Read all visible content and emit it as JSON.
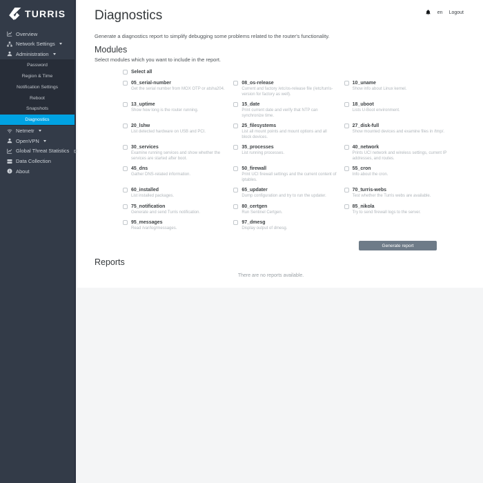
{
  "brand": {
    "name": "TURRIS"
  },
  "topbar": {
    "language": "en",
    "logout": "Logout"
  },
  "colors": {
    "sidebar_bg": "#333b48",
    "submenu_bg": "#272d38",
    "active_item": "#00a2e2",
    "button_bg": "#6e7b88",
    "page_bg": "#f4f5f6"
  },
  "sidebar": {
    "items_top": [
      {
        "label": "Overview",
        "icon": "line-chart",
        "caret": false
      },
      {
        "label": "Network Settings",
        "icon": "sitemap",
        "caret": true
      },
      {
        "label": "Administration",
        "icon": "user",
        "caret": true
      }
    ],
    "admin_submenu": [
      {
        "label": "Password",
        "active": false
      },
      {
        "label": "Region & Time",
        "active": false
      },
      {
        "label": "Notification Settings",
        "active": false
      },
      {
        "label": "Reboot",
        "active": false
      },
      {
        "label": "Snapshots",
        "active": false
      },
      {
        "label": "Diagnostics",
        "active": true
      }
    ],
    "items_bottom": [
      {
        "label": "Netmetr",
        "icon": "wifi",
        "caret": true
      },
      {
        "label": "OpenVPN",
        "icon": "user",
        "caret": true
      },
      {
        "label": "Global Threat Statistics",
        "icon": "line-chart",
        "caret": false,
        "external": true
      },
      {
        "label": "Data Collection",
        "icon": "server",
        "caret": false
      },
      {
        "label": "About",
        "icon": "info",
        "caret": false
      }
    ]
  },
  "page": {
    "title": "Diagnostics",
    "description": "Generate a diagnostics report to simplify debugging some problems related to the router's functionality.",
    "modules_heading": "Modules",
    "modules_hint": "Select modules which you want to include in the report.",
    "select_all": "Select all",
    "modules": [
      {
        "name": "05_serial-number",
        "desc": "Get the serial number from MOX OTP or atsha204."
      },
      {
        "name": "08_os-release",
        "desc": "Current and factory /etc/os-release file (/etc/turris-version for factory as well)."
      },
      {
        "name": "10_uname",
        "desc": "Show info about Linux kernel."
      },
      {
        "name": "13_uptime",
        "desc": "Show how long is the router running."
      },
      {
        "name": "15_date",
        "desc": "Print current date and verify that NTP can synchronize time."
      },
      {
        "name": "18_uboot",
        "desc": "Lists U-Boot environment."
      },
      {
        "name": "20_lshw",
        "desc": "List detected hardware on USB and PCI."
      },
      {
        "name": "25_filesystems",
        "desc": "List all mount points and mount options and all block devices."
      },
      {
        "name": "27_disk-full",
        "desc": "Show mounted devices and examine files in /tmp/."
      },
      {
        "name": "30_services",
        "desc": "Examine running services and show whether the services are started after boot."
      },
      {
        "name": "35_processes",
        "desc": "List running processes."
      },
      {
        "name": "40_network",
        "desc": "Prints UCI network and wireless settings, current IP addresses, and routes."
      },
      {
        "name": "45_dns",
        "desc": "Gather DNS-related information."
      },
      {
        "name": "50_firewall",
        "desc": "Print UCI firewall settings and the current content of iptables."
      },
      {
        "name": "55_cron",
        "desc": "Info about the cron."
      },
      {
        "name": "60_installed",
        "desc": "List installed packages."
      },
      {
        "name": "65_updater",
        "desc": "Dump configuration and try to run the updater."
      },
      {
        "name": "70_turris-webs",
        "desc": "Test whether the Turris webs are available."
      },
      {
        "name": "75_notification",
        "desc": "Generate and send Turris notification."
      },
      {
        "name": "80_certgen",
        "desc": "Run Sentinel Certgen."
      },
      {
        "name": "85_nikola",
        "desc": "Try to send firewall logs to the server."
      },
      {
        "name": "95_messages",
        "desc": "Read /var/log/messages."
      },
      {
        "name": "97_dmesg",
        "desc": "Display output of dmesg."
      }
    ],
    "generate_button": "Generate report",
    "reports_heading": "Reports",
    "reports_empty": "There are no reports available."
  }
}
